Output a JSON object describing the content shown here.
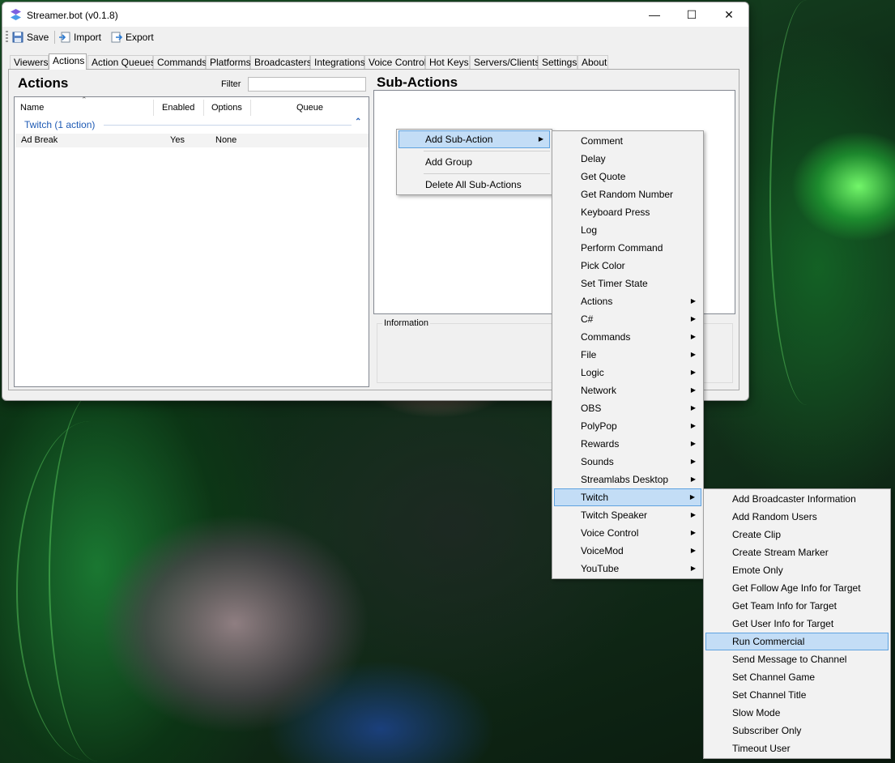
{
  "window": {
    "title": "Streamer.bot (v0.1.8)"
  },
  "toolbar": {
    "save": "Save",
    "import": "Import",
    "export": "Export"
  },
  "tabs": [
    "Viewers",
    "Actions",
    "Action Queues",
    "Commands",
    "Platforms",
    "Broadcasters",
    "Integrations",
    "Voice Control",
    "Hot Keys",
    "Servers/Clients",
    "Settings",
    "About"
  ],
  "actions_panel": {
    "title": "Actions",
    "filter_label": "Filter",
    "columns": [
      "Name",
      "Enabled",
      "Options",
      "Queue"
    ],
    "group": "Twitch  (1 action)",
    "rows": [
      {
        "name": "Ad Break",
        "enabled": "Yes",
        "options": "None"
      }
    ]
  },
  "subactions_panel": {
    "title": "Sub-Actions",
    "information_label": "Information"
  },
  "context_menu": [
    "Add Sub-Action",
    "Add Group",
    "Delete All Sub-Actions"
  ],
  "submenu": [
    "Comment",
    "Delay",
    "Get Quote",
    "Get Random Number",
    "Keyboard Press",
    "Log",
    "Perform Command",
    "Pick Color",
    "Set Timer State",
    "Actions",
    "C#",
    "Commands",
    "File",
    "Logic",
    "Network",
    "OBS",
    "PolyPop",
    "Rewards",
    "Sounds",
    "Streamlabs Desktop",
    "Twitch",
    "Twitch Speaker",
    "Voice Control",
    "VoiceMod",
    "YouTube"
  ],
  "twitch_submenu": [
    "Add Broadcaster Information",
    "Add Random Users",
    "Create Clip",
    "Create Stream Marker",
    "Emote Only",
    "Get Follow Age Info for Target",
    "Get Team Info for Target",
    "Get User Info for Target",
    "Run Commercial",
    "Send Message to Channel",
    "Set Channel Game",
    "Set Channel Title",
    "Slow Mode",
    "Subscriber Only",
    "Timeout User"
  ],
  "colors": {
    "highlight": "#c3ddf6",
    "highlight_border": "#5ea2e0",
    "group_text": "#1e5ab4"
  }
}
